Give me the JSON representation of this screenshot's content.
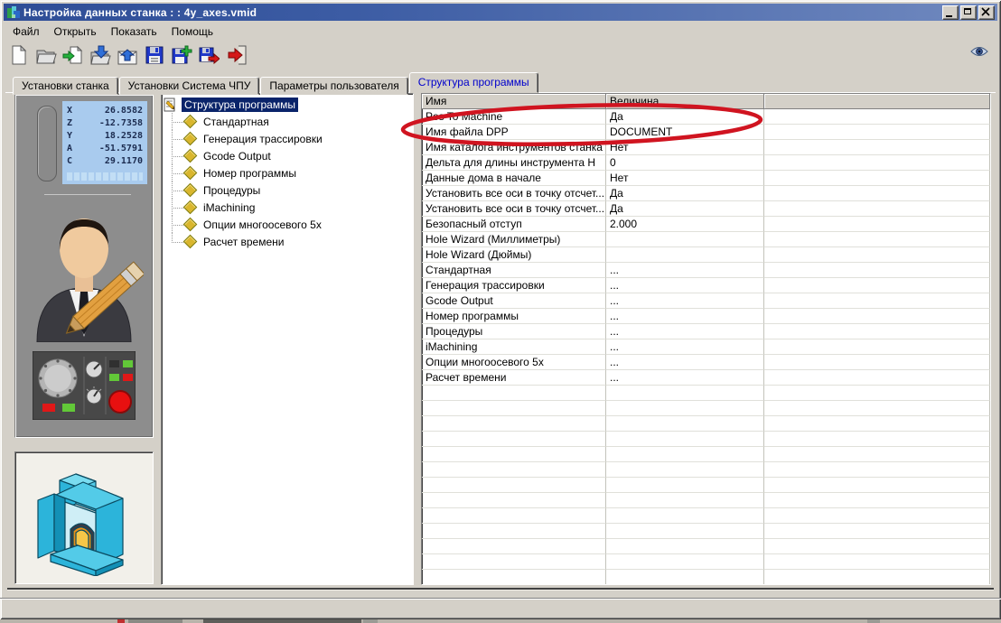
{
  "window": {
    "title": "Настройка данных станка : : 4y_axes.vmid",
    "buttons": [
      "minimize-icon",
      "maximize-icon",
      "close-icon"
    ]
  },
  "menu": {
    "items": [
      "Файл",
      "Открыть",
      "Показать",
      "Помощь"
    ]
  },
  "toolbar": {
    "icons": [
      "new-document-icon",
      "open-folder-icon",
      "import-page-icon",
      "open-into-folder-icon",
      "mail-send-icon",
      "save-icon",
      "save-new-icon",
      "save-export-icon",
      "exit-icon"
    ],
    "right_icon": "eye-icon"
  },
  "tabs": [
    {
      "label": "Установки станка",
      "active": false
    },
    {
      "label": "Установки Система ЧПУ",
      "active": false
    },
    {
      "label": "Параметры пользователя",
      "active": false
    },
    {
      "label": "Структура программы",
      "active": true
    }
  ],
  "dro": {
    "axes": [
      {
        "label": "X",
        "value": "26.8582"
      },
      {
        "label": "Z",
        "value": "-12.7358"
      },
      {
        "label": "Y",
        "value": "18.2528"
      },
      {
        "label": "A",
        "value": "-51.5791"
      },
      {
        "label": "C",
        "value": "29.1170"
      }
    ]
  },
  "tree": {
    "root": "Структура программы",
    "items": [
      "Стандартная",
      "Генерация трассировки",
      "Gcode Output",
      "Номер программы",
      "Процедуры",
      "iMachining",
      "Опции многоосевого 5x",
      "Расчет времени"
    ]
  },
  "table": {
    "columns": [
      "Имя",
      "Величина"
    ],
    "rows": [
      {
        "name": "Pos To Machine",
        "value": "Да"
      },
      {
        "name": "Имя файла DPP",
        "value": "DOCUMENT"
      },
      {
        "name": "Имя каталога инструментов станка",
        "value": "Нет"
      },
      {
        "name": "Дельта для длины инструмента H",
        "value": "0"
      },
      {
        "name": "Данные дома в начале",
        "value": "Нет"
      },
      {
        "name": "Установить все оси в точку отсчет...",
        "value": "Да"
      },
      {
        "name": "Установить все оси в точку отсчет...",
        "value": "Да"
      },
      {
        "name": "Безопасный отступ",
        "value": "2.000"
      },
      {
        "name": "Hole Wizard (Миллиметры)",
        "value": ""
      },
      {
        "name": "Hole Wizard (Дюймы)",
        "value": ""
      },
      {
        "name": "Стандартная",
        "value": "..."
      },
      {
        "name": "Генерация трассировки",
        "value": "..."
      },
      {
        "name": "Gcode Output",
        "value": "..."
      },
      {
        "name": "Номер программы",
        "value": "..."
      },
      {
        "name": "Процедуры",
        "value": "..."
      },
      {
        "name": "iMachining",
        "value": "..."
      },
      {
        "name": "Опции многоосевого 5x",
        "value": "..."
      },
      {
        "name": "Расчет времени",
        "value": "..."
      }
    ]
  },
  "annotation": {
    "shape": "ellipse",
    "target": "Pos To Machine",
    "color": "#d01420"
  }
}
